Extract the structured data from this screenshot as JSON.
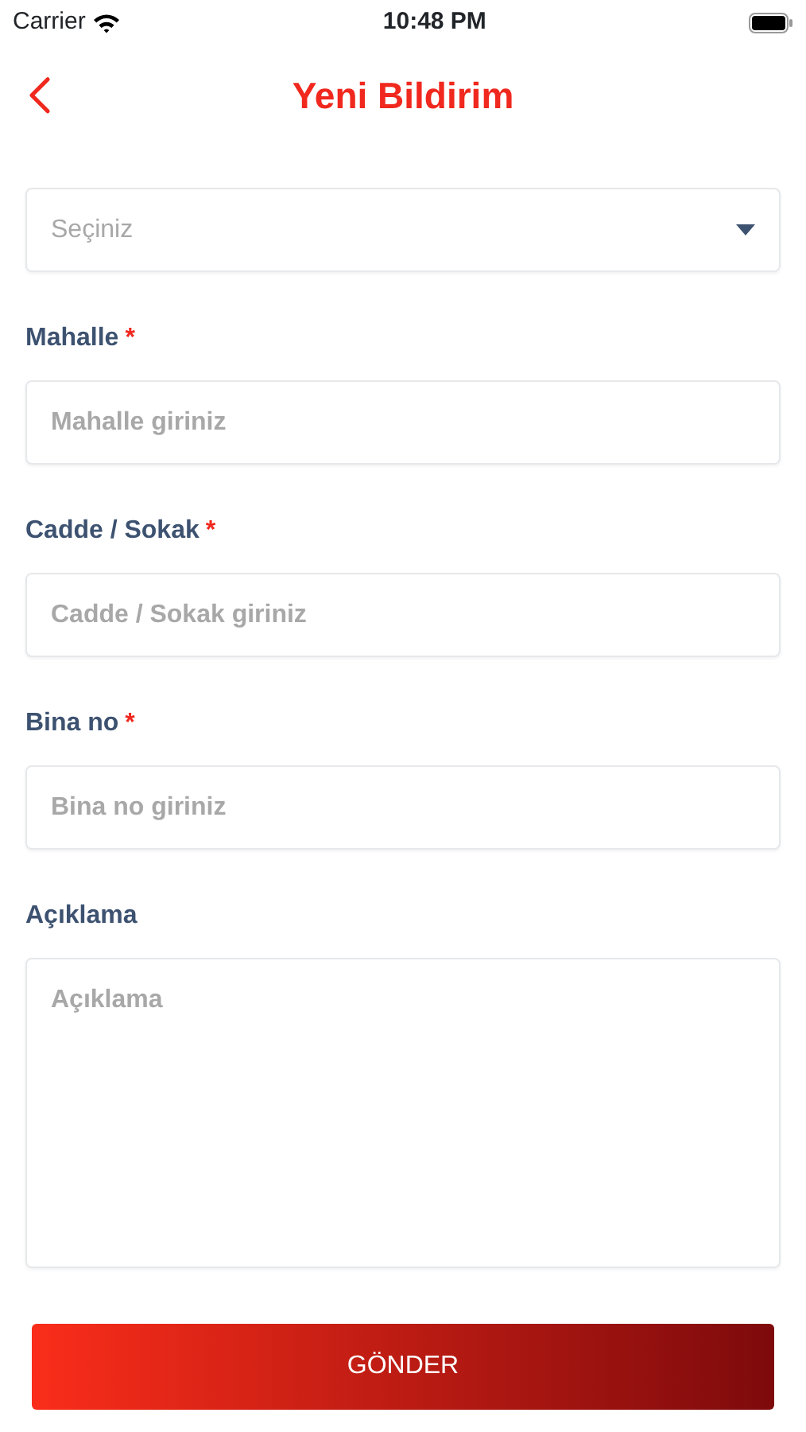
{
  "status_bar": {
    "carrier": "Carrier",
    "time": "10:48 PM"
  },
  "header": {
    "title": "Yeni Bildirim"
  },
  "fields": [
    {
      "kind": "select",
      "placeholder": "Seçiniz"
    },
    {
      "kind": "input",
      "label": "Mahalle",
      "required_mark": "*",
      "placeholder": "Mahalle giriniz"
    },
    {
      "kind": "input",
      "label": "Cadde / Sokak",
      "required_mark": "*",
      "placeholder": "Cadde / Sokak giriniz"
    },
    {
      "kind": "input",
      "label": "Bina no",
      "required_mark": "*",
      "placeholder": "Bina no giriniz"
    },
    {
      "kind": "textarea",
      "label": "Açıklama",
      "placeholder": "Açıklama"
    }
  ],
  "submit": {
    "label": "GÖNDER"
  }
}
